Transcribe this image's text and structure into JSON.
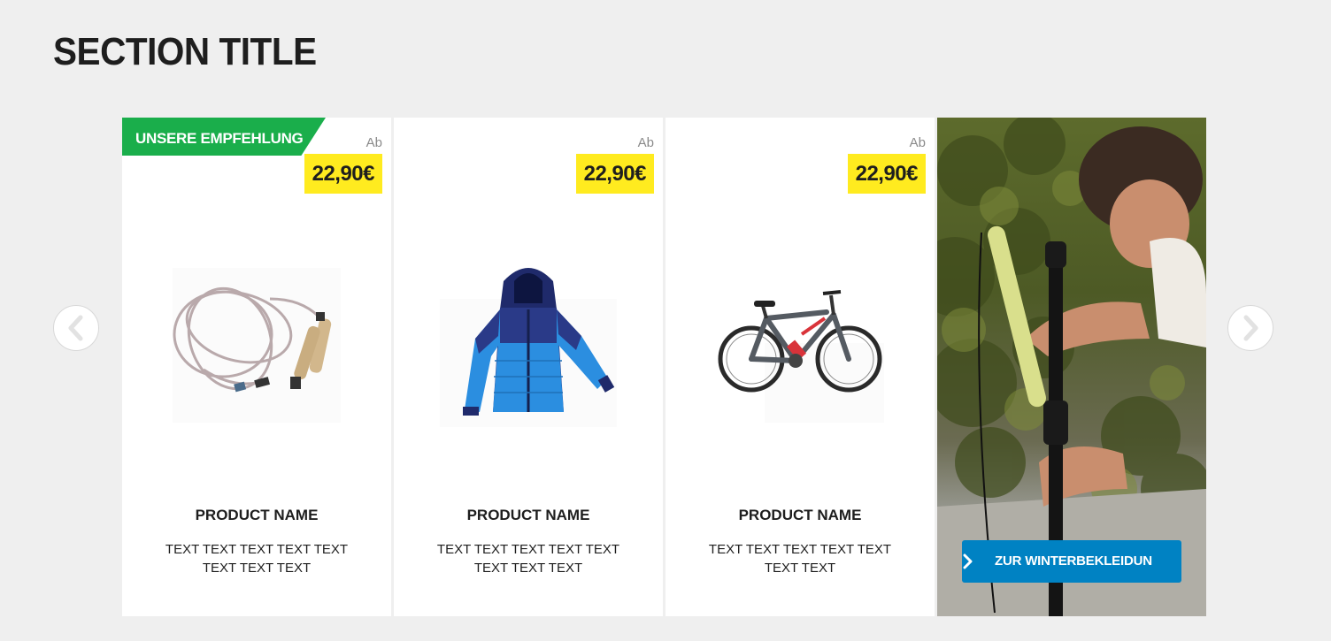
{
  "section": {
    "title": "SECTION TITLE"
  },
  "navigation": {
    "prev_icon": "chevron-left-icon",
    "next_icon": "chevron-right-icon"
  },
  "products": [
    {
      "ribbon": "UNSERE EMPFEHLUNG",
      "price_prefix": "Ab",
      "price": "22,90€",
      "image": "jump-rope-image",
      "name": "PRODUCT NAME",
      "description": "TEXT TEXT TEXT TEXT TEXT TEXT TEXT TEXT"
    },
    {
      "price_prefix": "Ab",
      "price": "22,90€",
      "image": "ski-jacket-image",
      "name": "PRODUCT NAME",
      "description": "TEXT TEXT TEXT TEXT TEXT TEXT TEXT TEXT"
    },
    {
      "price_prefix": "Ab",
      "price": "22,90€",
      "image": "hybrid-bike-image",
      "name": "PRODUCT NAME",
      "description": "TEXT TEXT TEXT TEXT TEXT TEXT TEXT"
    }
  ],
  "promo": {
    "image": "man-with-pole-photo",
    "button_label": "ZUR WINTERBEKLEIDUN",
    "button_icon": "chevron-right-icon"
  },
  "colors": {
    "background": "#efefef",
    "price_badge": "#ffeb1f",
    "ribbon": "#1aae4b",
    "promo_button": "#0082c3",
    "text": "#1e1e1e"
  }
}
